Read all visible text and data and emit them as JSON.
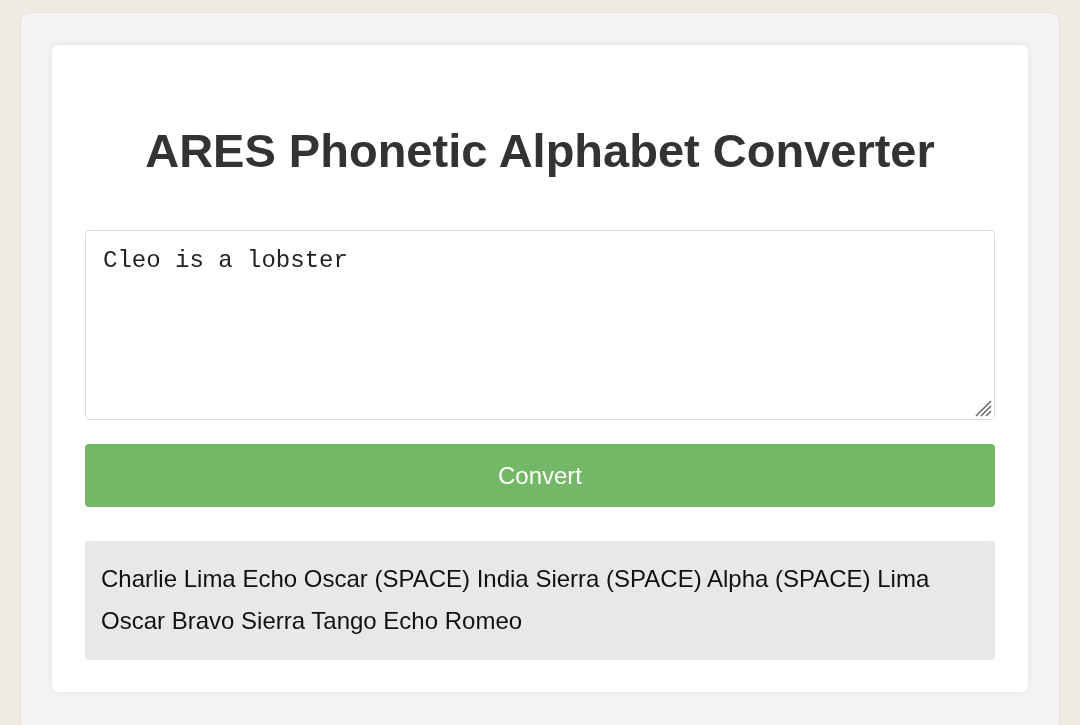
{
  "title": "ARES Phonetic Alphabet Converter",
  "input": {
    "value": "Cleo is a lobster"
  },
  "button": {
    "label": "Convert"
  },
  "output": {
    "text": "Charlie Lima Echo Oscar (SPACE) India Sierra (SPACE) Alpha (SPACE) Lima Oscar Bravo Sierra Tango Echo Romeo"
  }
}
